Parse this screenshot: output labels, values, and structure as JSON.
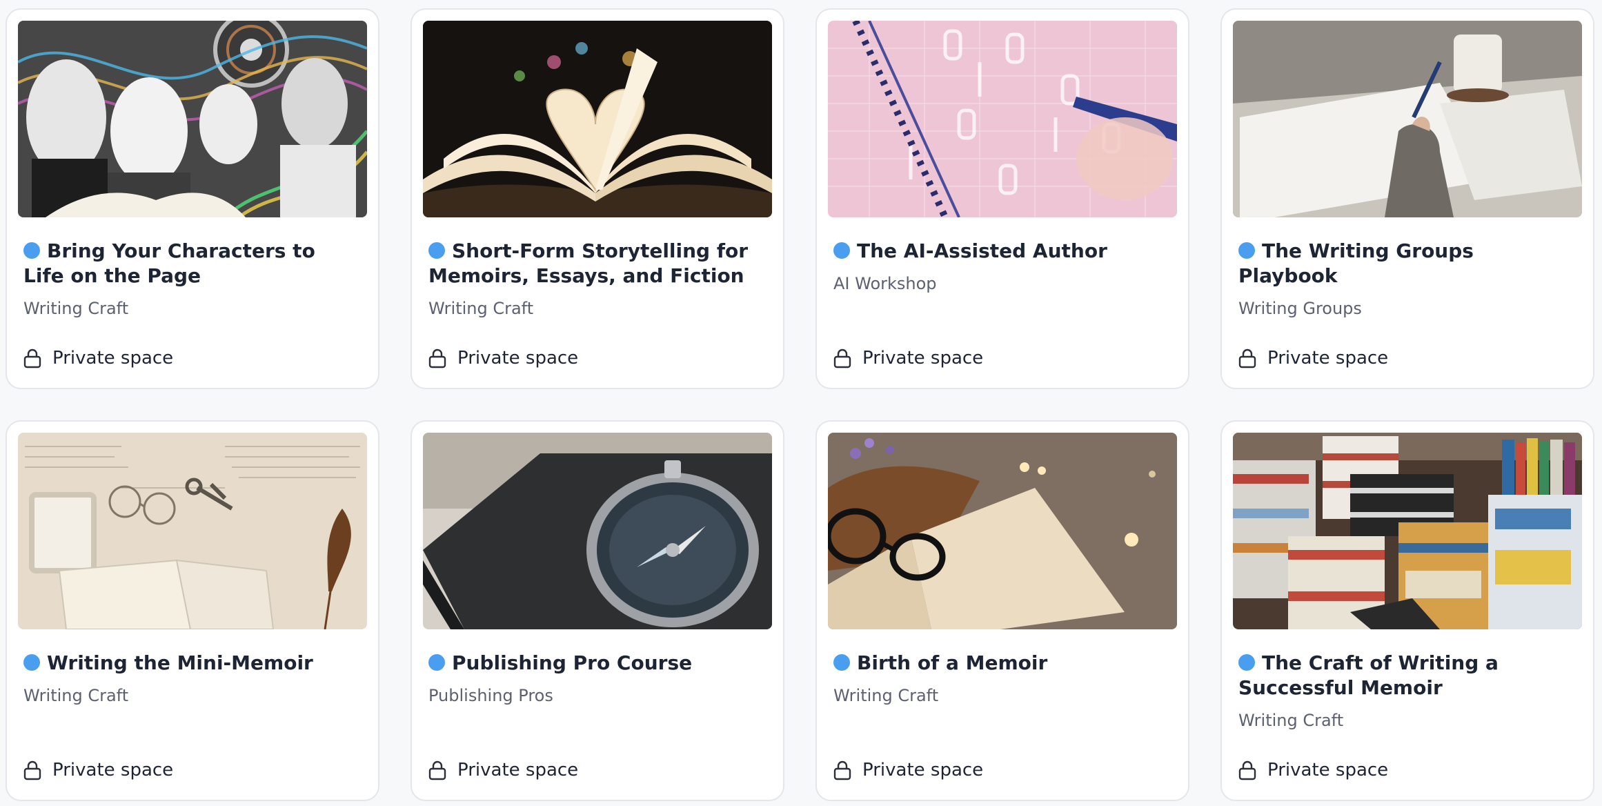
{
  "colors": {
    "dot": "#4a9ef0",
    "title": "#1d2433",
    "subtitle": "#5b6170",
    "card_border": "#e4e6eb",
    "background": "#f7f8fa"
  },
  "cards": [
    {
      "title": "Bring Your Characters to Life on the Page",
      "subtitle": "Writing Craft",
      "privacy_label": "Private space",
      "privacy_icon": "lock-icon",
      "image": "black-and-white portraits of people with colorful waves and a film reel"
    },
    {
      "title": "Short-Form Storytelling for Memoirs, Essays, and Fiction",
      "subtitle": "Writing Craft",
      "privacy_label": "Private space",
      "privacy_icon": "lock-icon",
      "image": "open book with pages folded into a heart shape"
    },
    {
      "title": "The AI-Assisted Author",
      "subtitle": "AI Workshop",
      "privacy_label": "Private space",
      "privacy_icon": "lock-icon",
      "image": "pink overlay of digits over a spiral notebook and pen"
    },
    {
      "title": "The Writing Groups Playbook",
      "subtitle": "Writing Groups",
      "privacy_label": "Private space",
      "privacy_icon": "lock-icon",
      "image": "hand writing in a notebook beside a coffee mug"
    },
    {
      "title": "Writing the Mini-Memoir",
      "subtitle": "Writing Craft",
      "privacy_label": "Private space",
      "privacy_icon": "lock-icon",
      "image": "old letters, spectacles, keys, a frame and a quill pen"
    },
    {
      "title": "Publishing Pro Course",
      "subtitle": "Publishing Pros",
      "privacy_label": "Private space",
      "privacy_icon": "lock-icon",
      "image": "compass resting on a dark notebook"
    },
    {
      "title": "Birth of a Memoir",
      "subtitle": "Writing Craft",
      "privacy_label": "Private space",
      "privacy_icon": "lock-icon",
      "image": "open book with glasses, lavender and bokeh lights"
    },
    {
      "title": "The Craft of Writing a Successful Memoir",
      "subtitle": "Writing Craft",
      "privacy_label": "Private space",
      "privacy_icon": "lock-icon",
      "image": "stacks of books on a bookstore table"
    }
  ]
}
